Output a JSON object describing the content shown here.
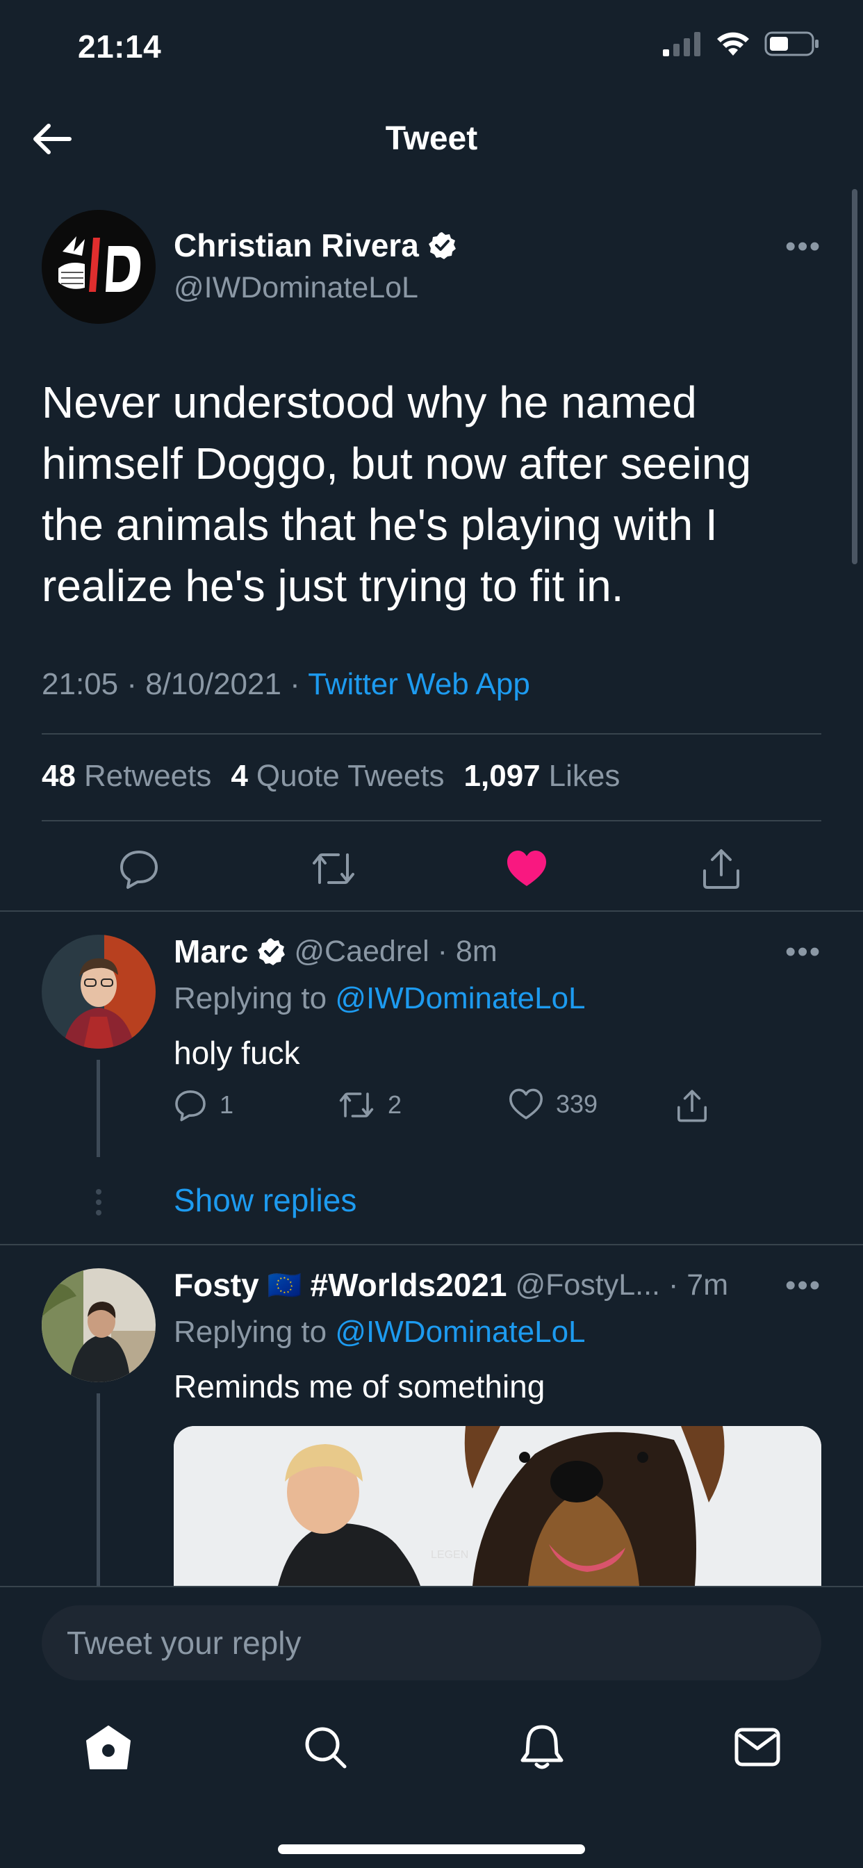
{
  "status_bar": {
    "time": "21:14"
  },
  "header": {
    "title": "Tweet"
  },
  "tweet": {
    "author_name": "Christian Rivera",
    "author_handle": "@IWDominateLoL",
    "text": "Never understood why he named\nhimself Doggo, but now after seeing\nthe animals that he's playing with I\nrealize he's just trying to fit in.",
    "time_date": "21:05 · 8/10/2021 ·",
    "source": "Twitter Web App",
    "retweets_count": "48",
    "retweets_label": "Retweets",
    "quotes_count": "4",
    "quotes_label": "Quote Tweets",
    "likes_count": "1,097",
    "likes_label": "Likes",
    "liked": true,
    "like_color": "#f91880"
  },
  "replies": [
    {
      "name": "Marc",
      "handle": "@Caedrel",
      "time": "· 8m",
      "replying_prefix": "Replying to",
      "replying_handle": "@IWDominateLoL",
      "text": "holy fuck",
      "reply_count": "1",
      "retweet_count": "2",
      "like_count": "339"
    },
    {
      "name": "Fosty",
      "flag": "🇪🇺",
      "tag": "#Worlds2021",
      "handle": "@FostyL...",
      "time": "· 7m",
      "replying_prefix": "Replying to",
      "replying_handle": "@IWDominateLoL",
      "text": "Reminds me of something"
    }
  ],
  "show_replies_label": "Show replies",
  "reply_box": {
    "placeholder": "Tweet your reply"
  },
  "colors": {
    "background": "#15202b",
    "accent": "#1d9bf0",
    "secondary_text": "#8b98a5",
    "divider": "#38444d"
  }
}
